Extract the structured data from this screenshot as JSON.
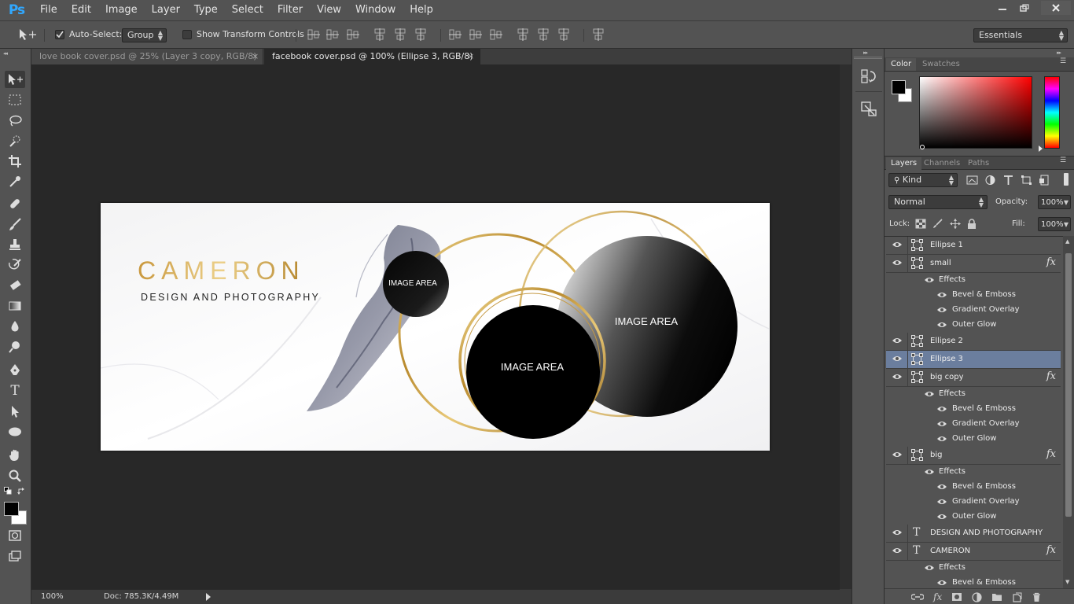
{
  "app": {
    "logo": "Ps"
  },
  "menu": [
    "File",
    "Edit",
    "Image",
    "Layer",
    "Type",
    "Select",
    "Filter",
    "View",
    "Window",
    "Help"
  ],
  "options": {
    "auto_select_label": "Auto-Select:",
    "auto_select_checked": true,
    "auto_select_value": "Group",
    "show_transform_label": "Show Transform Controls",
    "show_transform_checked": false,
    "workspace": "Essentials"
  },
  "tabs": [
    {
      "label": "love book cover.psd @ 25% (Layer 3 copy, RGB/8)",
      "active": false
    },
    {
      "label": "facebook cover.psd @ 100% (Ellipse 3, RGB/8)",
      "active": true
    }
  ],
  "tab_close_glyph": "×",
  "document": {
    "title": "CAMERON",
    "subtitle": "DESIGN AND PHOTOGRAPHY",
    "image_area_small": "IMAGE AREA",
    "image_area_big": "IMAGE AREA",
    "image_area_medium": "IMAGE AREA"
  },
  "status": {
    "zoom": "100%",
    "doc": "Doc: 785.3K/4.49M"
  },
  "color_panel": {
    "tabs": [
      "Color",
      "Swatches"
    ],
    "fg_color": "#000000",
    "bg_color": "#ffffff",
    "hue_color": "#ff0000"
  },
  "layers_panel": {
    "tabs": [
      "Layers",
      "Channels",
      "Paths"
    ],
    "kind_label": "Kind",
    "blend_mode": "Normal",
    "opacity_label": "Opacity:",
    "opacity_value": "100%",
    "lock_label": "Lock:",
    "fill_label": "Fill:",
    "fill_value": "100%",
    "rows": [
      {
        "kind": "shape",
        "name": "Ellipse 1"
      },
      {
        "kind": "shape",
        "name": "small",
        "fx": "fx"
      },
      {
        "kind": "effects",
        "name": "Effects"
      },
      {
        "kind": "effect",
        "name": "Bevel & Emboss"
      },
      {
        "kind": "effect",
        "name": "Gradient Overlay"
      },
      {
        "kind": "effect",
        "name": "Outer Glow"
      },
      {
        "kind": "shape",
        "name": "Ellipse 2"
      },
      {
        "kind": "shape",
        "name": "Ellipse 3",
        "selected": true
      },
      {
        "kind": "shape",
        "name": "big copy",
        "fx": "fx"
      },
      {
        "kind": "effects",
        "name": "Effects"
      },
      {
        "kind": "effect",
        "name": "Bevel & Emboss"
      },
      {
        "kind": "effect",
        "name": "Gradient Overlay"
      },
      {
        "kind": "effect",
        "name": "Outer Glow"
      },
      {
        "kind": "shape",
        "name": "big",
        "fx": "fx"
      },
      {
        "kind": "effects",
        "name": "Effects"
      },
      {
        "kind": "effect",
        "name": "Bevel & Emboss"
      },
      {
        "kind": "effect",
        "name": "Gradient Overlay"
      },
      {
        "kind": "effect",
        "name": "Outer Glow"
      },
      {
        "kind": "text",
        "name": "DESIGN AND PHOTOGRAPHY"
      },
      {
        "kind": "text",
        "name": "CAMERON",
        "fx": "fx"
      },
      {
        "kind": "effects",
        "name": "Effects"
      },
      {
        "kind": "effect",
        "name": "Bevel & Emboss"
      }
    ],
    "type_glyph": "T"
  },
  "colors": {
    "accent_gold": "#d9b15a",
    "selected_row": "#6b7e9e",
    "ps_blue": "#31a8ff"
  }
}
